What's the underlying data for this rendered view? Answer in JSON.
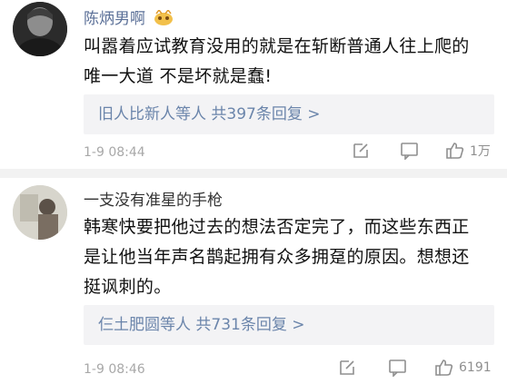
{
  "comments": [
    {
      "username": "陈炳男啊",
      "text_lines": [
        "叫嚣着应试教育没用的就是在斩断普通人往上爬的",
        "唯一大道 不是坏就是蠢!"
      ],
      "replies_summary": "旧人比新人等人  共397条回复 >",
      "timestamp": "1-9 08:44",
      "like_count": "1万",
      "icons": {
        "badge": "vip-badge-icon",
        "edit": "edit-icon",
        "comment": "comment-icon",
        "like": "thumbs-up-icon"
      }
    },
    {
      "username": "一支没有准星的手枪",
      "text_lines": [
        "韩寒快要把他过去的想法否定完了，而这些东西正",
        "是让他当年声名鹊起拥有众多拥趸的原因。想想还",
        "挺讽刺的。"
      ],
      "replies_summary": "仨土肥圆等人  共731条回复 >",
      "timestamp": "1-9 08:46",
      "like_count": "6191",
      "icons": {
        "edit": "edit-icon",
        "comment": "comment-icon",
        "like": "thumbs-up-icon"
      }
    }
  ],
  "colors": {
    "username": "#5a6f97",
    "reply_link": "#6b85ab",
    "meta": "#a8a8a8",
    "divider": "#f2f2f2",
    "reply_bg": "#f3f3f5"
  }
}
